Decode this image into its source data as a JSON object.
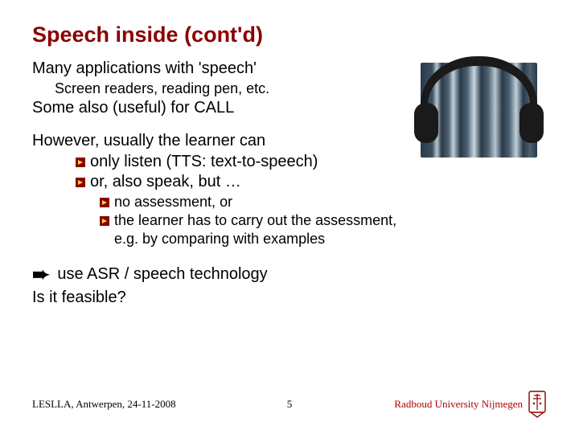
{
  "title": "Speech inside (cont'd)",
  "lines": {
    "l1": "Many applications with 'speech'",
    "l2": "Screen readers, reading pen, etc.",
    "l3": "Some also (useful) for CALL",
    "l4": "However, usually the learner can",
    "b1a": "only listen (TTS: text-to-speech)",
    "b1b": "or, also speak, but …",
    "b2a": "no assessment, or",
    "b2b": "the learner has to carry out the assessment,",
    "b2b_cont": "e.g. by comparing with examples",
    "l5": " use ASR / speech technology",
    "l6": "Is it feasible?"
  },
  "arrow_glyph": "➔",
  "big_arrow": "➨",
  "footer": {
    "left": "LESLLA, Antwerpen, 24-11-2008",
    "page": "5",
    "right": "Radboud University Nijmegen"
  },
  "image_alt": "books-with-headphones"
}
